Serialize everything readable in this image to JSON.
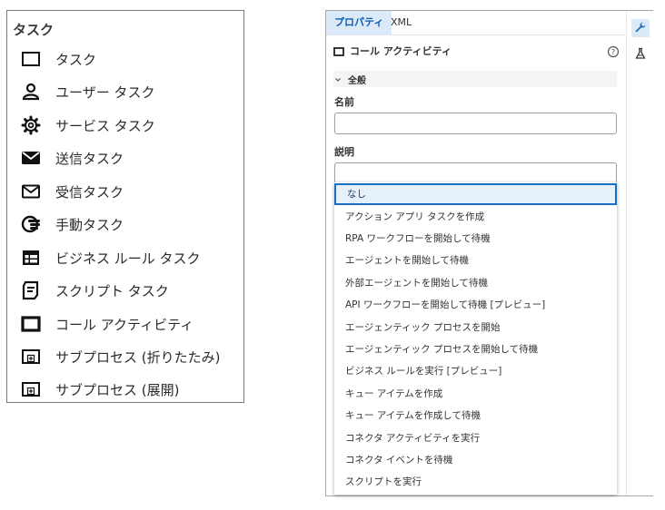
{
  "palette": {
    "title": "タスク",
    "items": [
      {
        "label": "タスク",
        "icon": "task-icon"
      },
      {
        "label": "ユーザー タスク",
        "icon": "user-icon"
      },
      {
        "label": "サービス タスク",
        "icon": "gear-icon"
      },
      {
        "label": "送信タスク",
        "icon": "envelope-filled-icon"
      },
      {
        "label": "受信タスク",
        "icon": "envelope-outline-icon"
      },
      {
        "label": "手動タスク",
        "icon": "hand-icon"
      },
      {
        "label": "ビジネス ルール タスク",
        "icon": "table-icon"
      },
      {
        "label": "スクリプト タスク",
        "icon": "script-icon"
      },
      {
        "label": "コール アクティビティ",
        "icon": "call-activity-icon"
      },
      {
        "label": "サブプロセス (折りたたみ)",
        "icon": "subprocess-collapsed-icon"
      },
      {
        "label": "サブプロセス (展開)",
        "icon": "subprocess-expanded-icon"
      }
    ]
  },
  "panel": {
    "tabs": [
      {
        "label": "プロパティ",
        "active": true
      },
      {
        "label": "XML",
        "active": false
      }
    ],
    "rail": [
      {
        "icon": "wrench-icon",
        "active": true
      },
      {
        "icon": "flask-icon",
        "active": false
      }
    ],
    "element_title": "コール アクティビティ",
    "section_title": "全般",
    "name_label": "名前",
    "name_value": "",
    "description_label": "説明",
    "description_value": "",
    "dropdown_options": [
      "なし",
      "アクション アプリ タスクを作成",
      "RPA ワークフローを開始して待機",
      "エージェントを開始して待機",
      "外部エージェントを開始して待機",
      "API ワークフローを開始して待機 [プレビュー]",
      "エージェンティック プロセスを開始",
      "エージェンティック プロセスを開始して待機",
      "ビジネス ルールを実行 [プレビュー]",
      "キュー アイテムを作成",
      "キュー アイテムを作成して待機",
      "コネクタ アクティビティを実行",
      "コネクタ イベントを待機",
      "スクリプトを実行"
    ],
    "selected_index": 0
  },
  "colors": {
    "accent": "#1b6ec2",
    "tab_active_bg": "#dbe9f8",
    "selected_bg": "#e6f0fb"
  }
}
